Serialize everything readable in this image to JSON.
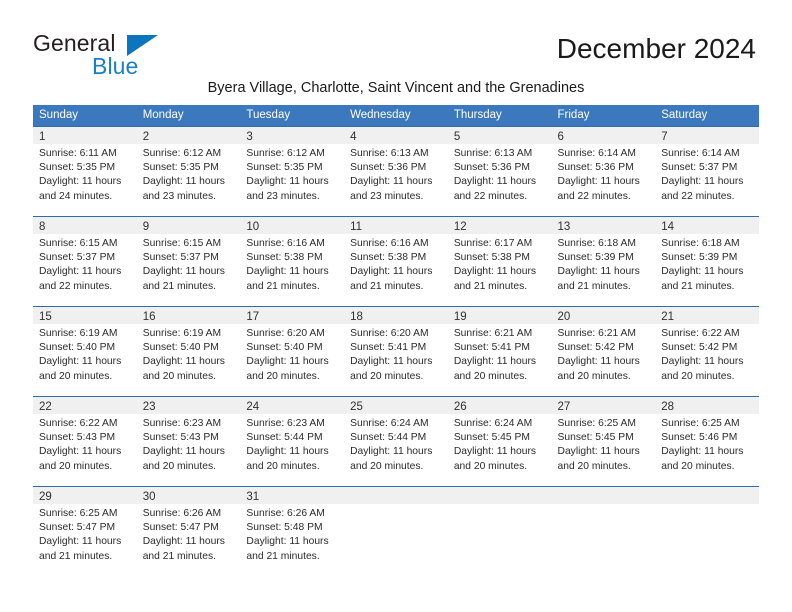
{
  "brand": {
    "name_part1": "General",
    "name_part2": "Blue",
    "triangle_icon": "triangle-icon",
    "accent_color": "#1b7fc4"
  },
  "header": {
    "title": "December 2024",
    "subtitle": "Byera Village, Charlotte, Saint Vincent and the Grenadines"
  },
  "theme": {
    "header_blue": "#3b78bd",
    "row_border": "#2e6da9",
    "day_band": "#f0f0f0"
  },
  "calendar": {
    "weekdays": [
      "Sunday",
      "Monday",
      "Tuesday",
      "Wednesday",
      "Thursday",
      "Friday",
      "Saturday"
    ],
    "weeks": [
      [
        {
          "day": "1",
          "sunrise": "Sunrise: 6:11 AM",
          "sunset": "Sunset: 5:35 PM",
          "daylight1": "Daylight: 11 hours",
          "daylight2": "and 24 minutes."
        },
        {
          "day": "2",
          "sunrise": "Sunrise: 6:12 AM",
          "sunset": "Sunset: 5:35 PM",
          "daylight1": "Daylight: 11 hours",
          "daylight2": "and 23 minutes."
        },
        {
          "day": "3",
          "sunrise": "Sunrise: 6:12 AM",
          "sunset": "Sunset: 5:35 PM",
          "daylight1": "Daylight: 11 hours",
          "daylight2": "and 23 minutes."
        },
        {
          "day": "4",
          "sunrise": "Sunrise: 6:13 AM",
          "sunset": "Sunset: 5:36 PM",
          "daylight1": "Daylight: 11 hours",
          "daylight2": "and 23 minutes."
        },
        {
          "day": "5",
          "sunrise": "Sunrise: 6:13 AM",
          "sunset": "Sunset: 5:36 PM",
          "daylight1": "Daylight: 11 hours",
          "daylight2": "and 22 minutes."
        },
        {
          "day": "6",
          "sunrise": "Sunrise: 6:14 AM",
          "sunset": "Sunset: 5:36 PM",
          "daylight1": "Daylight: 11 hours",
          "daylight2": "and 22 minutes."
        },
        {
          "day": "7",
          "sunrise": "Sunrise: 6:14 AM",
          "sunset": "Sunset: 5:37 PM",
          "daylight1": "Daylight: 11 hours",
          "daylight2": "and 22 minutes."
        }
      ],
      [
        {
          "day": "8",
          "sunrise": "Sunrise: 6:15 AM",
          "sunset": "Sunset: 5:37 PM",
          "daylight1": "Daylight: 11 hours",
          "daylight2": "and 22 minutes."
        },
        {
          "day": "9",
          "sunrise": "Sunrise: 6:15 AM",
          "sunset": "Sunset: 5:37 PM",
          "daylight1": "Daylight: 11 hours",
          "daylight2": "and 21 minutes."
        },
        {
          "day": "10",
          "sunrise": "Sunrise: 6:16 AM",
          "sunset": "Sunset: 5:38 PM",
          "daylight1": "Daylight: 11 hours",
          "daylight2": "and 21 minutes."
        },
        {
          "day": "11",
          "sunrise": "Sunrise: 6:16 AM",
          "sunset": "Sunset: 5:38 PM",
          "daylight1": "Daylight: 11 hours",
          "daylight2": "and 21 minutes."
        },
        {
          "day": "12",
          "sunrise": "Sunrise: 6:17 AM",
          "sunset": "Sunset: 5:38 PM",
          "daylight1": "Daylight: 11 hours",
          "daylight2": "and 21 minutes."
        },
        {
          "day": "13",
          "sunrise": "Sunrise: 6:18 AM",
          "sunset": "Sunset: 5:39 PM",
          "daylight1": "Daylight: 11 hours",
          "daylight2": "and 21 minutes."
        },
        {
          "day": "14",
          "sunrise": "Sunrise: 6:18 AM",
          "sunset": "Sunset: 5:39 PM",
          "daylight1": "Daylight: 11 hours",
          "daylight2": "and 21 minutes."
        }
      ],
      [
        {
          "day": "15",
          "sunrise": "Sunrise: 6:19 AM",
          "sunset": "Sunset: 5:40 PM",
          "daylight1": "Daylight: 11 hours",
          "daylight2": "and 20 minutes."
        },
        {
          "day": "16",
          "sunrise": "Sunrise: 6:19 AM",
          "sunset": "Sunset: 5:40 PM",
          "daylight1": "Daylight: 11 hours",
          "daylight2": "and 20 minutes."
        },
        {
          "day": "17",
          "sunrise": "Sunrise: 6:20 AM",
          "sunset": "Sunset: 5:40 PM",
          "daylight1": "Daylight: 11 hours",
          "daylight2": "and 20 minutes."
        },
        {
          "day": "18",
          "sunrise": "Sunrise: 6:20 AM",
          "sunset": "Sunset: 5:41 PM",
          "daylight1": "Daylight: 11 hours",
          "daylight2": "and 20 minutes."
        },
        {
          "day": "19",
          "sunrise": "Sunrise: 6:21 AM",
          "sunset": "Sunset: 5:41 PM",
          "daylight1": "Daylight: 11 hours",
          "daylight2": "and 20 minutes."
        },
        {
          "day": "20",
          "sunrise": "Sunrise: 6:21 AM",
          "sunset": "Sunset: 5:42 PM",
          "daylight1": "Daylight: 11 hours",
          "daylight2": "and 20 minutes."
        },
        {
          "day": "21",
          "sunrise": "Sunrise: 6:22 AM",
          "sunset": "Sunset: 5:42 PM",
          "daylight1": "Daylight: 11 hours",
          "daylight2": "and 20 minutes."
        }
      ],
      [
        {
          "day": "22",
          "sunrise": "Sunrise: 6:22 AM",
          "sunset": "Sunset: 5:43 PM",
          "daylight1": "Daylight: 11 hours",
          "daylight2": "and 20 minutes."
        },
        {
          "day": "23",
          "sunrise": "Sunrise: 6:23 AM",
          "sunset": "Sunset: 5:43 PM",
          "daylight1": "Daylight: 11 hours",
          "daylight2": "and 20 minutes."
        },
        {
          "day": "24",
          "sunrise": "Sunrise: 6:23 AM",
          "sunset": "Sunset: 5:44 PM",
          "daylight1": "Daylight: 11 hours",
          "daylight2": "and 20 minutes."
        },
        {
          "day": "25",
          "sunrise": "Sunrise: 6:24 AM",
          "sunset": "Sunset: 5:44 PM",
          "daylight1": "Daylight: 11 hours",
          "daylight2": "and 20 minutes."
        },
        {
          "day": "26",
          "sunrise": "Sunrise: 6:24 AM",
          "sunset": "Sunset: 5:45 PM",
          "daylight1": "Daylight: 11 hours",
          "daylight2": "and 20 minutes."
        },
        {
          "day": "27",
          "sunrise": "Sunrise: 6:25 AM",
          "sunset": "Sunset: 5:45 PM",
          "daylight1": "Daylight: 11 hours",
          "daylight2": "and 20 minutes."
        },
        {
          "day": "28",
          "sunrise": "Sunrise: 6:25 AM",
          "sunset": "Sunset: 5:46 PM",
          "daylight1": "Daylight: 11 hours",
          "daylight2": "and 20 minutes."
        }
      ],
      [
        {
          "day": "29",
          "sunrise": "Sunrise: 6:25 AM",
          "sunset": "Sunset: 5:47 PM",
          "daylight1": "Daylight: 11 hours",
          "daylight2": "and 21 minutes."
        },
        {
          "day": "30",
          "sunrise": "Sunrise: 6:26 AM",
          "sunset": "Sunset: 5:47 PM",
          "daylight1": "Daylight: 11 hours",
          "daylight2": "and 21 minutes."
        },
        {
          "day": "31",
          "sunrise": "Sunrise: 6:26 AM",
          "sunset": "Sunset: 5:48 PM",
          "daylight1": "Daylight: 11 hours",
          "daylight2": "and 21 minutes."
        },
        {
          "day": "",
          "sunrise": "",
          "sunset": "",
          "daylight1": "",
          "daylight2": ""
        },
        {
          "day": "",
          "sunrise": "",
          "sunset": "",
          "daylight1": "",
          "daylight2": ""
        },
        {
          "day": "",
          "sunrise": "",
          "sunset": "",
          "daylight1": "",
          "daylight2": ""
        },
        {
          "day": "",
          "sunrise": "",
          "sunset": "",
          "daylight1": "",
          "daylight2": ""
        }
      ]
    ]
  }
}
